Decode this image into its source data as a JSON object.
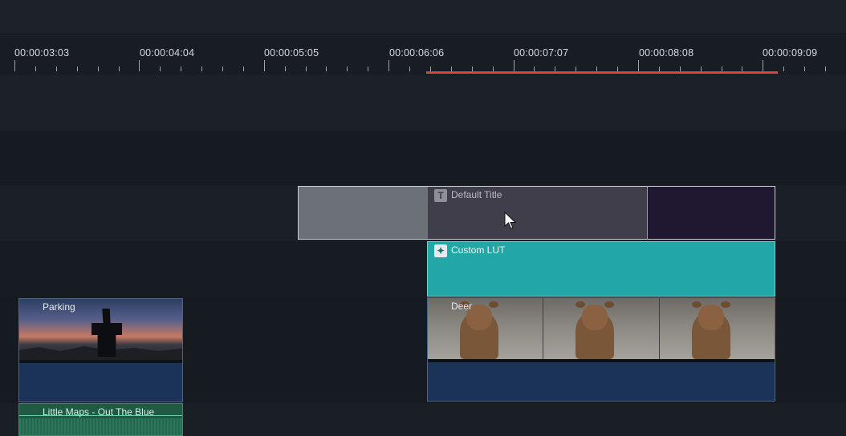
{
  "ruler": {
    "timecodes": [
      "00:00:03:03",
      "00:00:04:04",
      "00:00:05:05",
      "00:00:06:06",
      "00:00:07:07",
      "00:00:08:08",
      "00:00:09:09"
    ],
    "playrange_color": "#d9453c"
  },
  "tracks": {
    "title_track": {
      "clip_label": "Default Title",
      "icon": "text-title-icon"
    },
    "effects_track": {
      "clip_label": "Custom LUT",
      "icon": "lut-effect-icon"
    },
    "video_track": {
      "clips": [
        {
          "label": "Parking"
        },
        {
          "label": "Deer"
        }
      ]
    },
    "audio_track": {
      "clip_label": "Little Maps - Out The Blue"
    }
  },
  "colors": {
    "background": "#171b22",
    "effect_clip": "#23a7a6",
    "video_clip": "#1b3356",
    "audio_clip": "#1e5a46"
  },
  "cursor": "mouse-pointer-icon"
}
